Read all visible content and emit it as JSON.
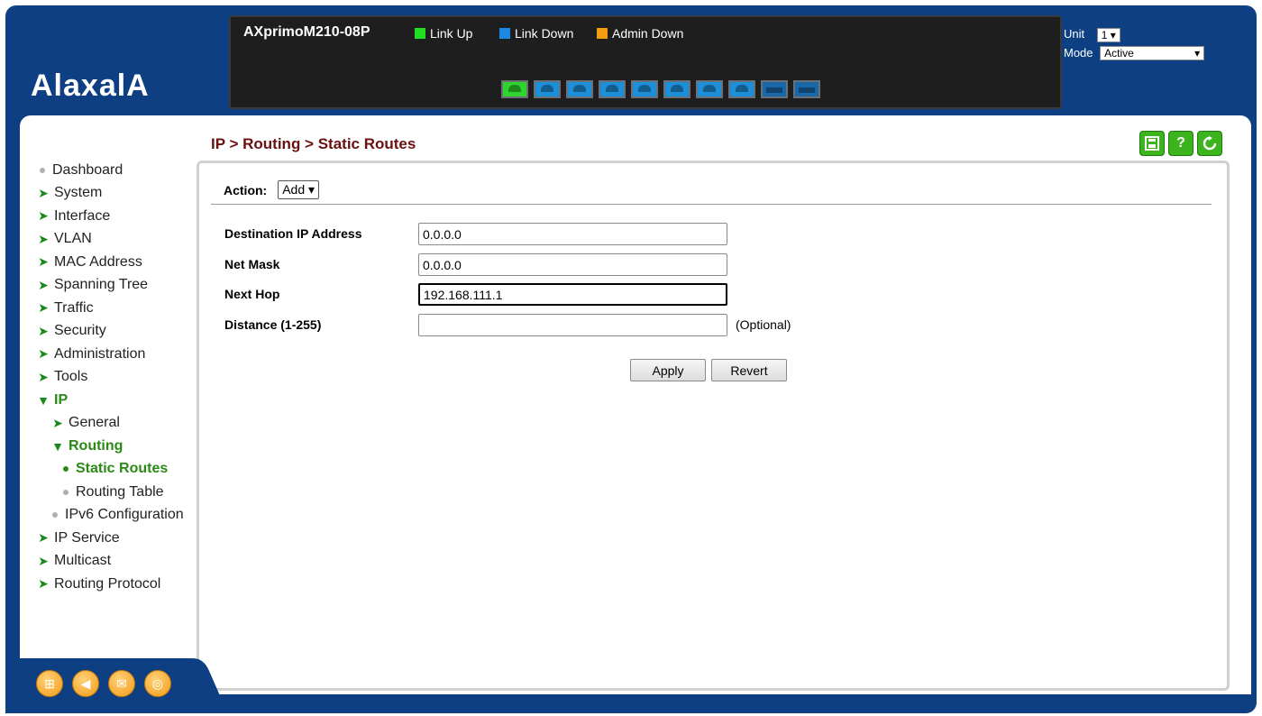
{
  "brand": {
    "logo": "AlaxalA"
  },
  "device": {
    "model": "AXprimoM210-08P",
    "legend": [
      {
        "label": "Link Up",
        "color": "#22dd22"
      },
      {
        "label": "Link Down",
        "color": "#1e88e5"
      },
      {
        "label": "Admin Down",
        "color": "#f39c12"
      }
    ],
    "ports": [
      {
        "state": "up"
      },
      {
        "state": "down"
      },
      {
        "state": "down"
      },
      {
        "state": "down"
      },
      {
        "state": "down"
      },
      {
        "state": "down"
      },
      {
        "state": "down"
      },
      {
        "state": "down"
      },
      {
        "state": "sfp"
      },
      {
        "state": "sfp"
      }
    ]
  },
  "unit": {
    "label": "Unit",
    "value": "1"
  },
  "mode": {
    "label": "Mode",
    "value": "Active"
  },
  "breadcrumb": "IP > Routing > Static Routes",
  "toolbar": {
    "save": "save-icon",
    "help": "?",
    "refresh": "refresh-icon"
  },
  "sidebar": {
    "items": [
      {
        "label": "Dashboard",
        "marker": "dot"
      },
      {
        "label": "System",
        "marker": "arrow"
      },
      {
        "label": "Interface",
        "marker": "arrow"
      },
      {
        "label": "VLAN",
        "marker": "arrow"
      },
      {
        "label": "MAC Address",
        "marker": "arrow"
      },
      {
        "label": "Spanning Tree",
        "marker": "arrow"
      },
      {
        "label": "Traffic",
        "marker": "arrow"
      },
      {
        "label": "Security",
        "marker": "arrow"
      },
      {
        "label": "Administration",
        "marker": "arrow"
      },
      {
        "label": "Tools",
        "marker": "arrow"
      },
      {
        "label": "IP",
        "marker": "open"
      },
      {
        "label": "General",
        "marker": "arrow"
      },
      {
        "label": "Routing",
        "marker": "open"
      },
      {
        "label": "Static Routes",
        "marker": "dot"
      },
      {
        "label": "Routing Table",
        "marker": "dot"
      },
      {
        "label": "IPv6 Configuration",
        "marker": "dot"
      },
      {
        "label": "IP Service",
        "marker": "arrow"
      },
      {
        "label": "Multicast",
        "marker": "arrow"
      },
      {
        "label": "Routing Protocol",
        "marker": "arrow"
      }
    ]
  },
  "form": {
    "action_label": "Action:",
    "action_value": "Add",
    "fields": [
      {
        "label": "Destination IP Address",
        "value": "0.0.0.0"
      },
      {
        "label": "Net Mask",
        "value": "0.0.0.0"
      },
      {
        "label": "Next Hop",
        "value": "192.168.111.1"
      },
      {
        "label": "Distance (1-255)",
        "value": ""
      }
    ],
    "optional_note": "(Optional)",
    "apply_label": "Apply",
    "revert_label": "Revert"
  },
  "footer_icons": [
    "sitemap-icon",
    "back-icon",
    "mail-icon",
    "globe-icon"
  ]
}
